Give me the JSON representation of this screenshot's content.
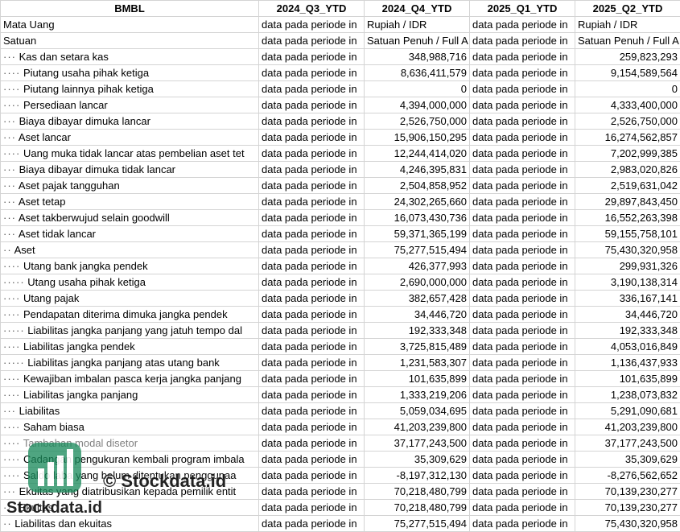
{
  "header": {
    "col0": "BMBL",
    "periods": [
      "2024_Q3_YTD",
      "2024_Q4_YTD",
      "2025_Q1_YTD",
      "2025_Q2_YTD"
    ]
  },
  "rows": [
    {
      "label": "Mata Uang",
      "dots": "",
      "v": [
        "data pada periode in",
        "Rupiah / IDR",
        "data pada periode in",
        "Rupiah / IDR"
      ],
      "t": [
        "txt",
        "txt",
        "txt",
        "txt"
      ]
    },
    {
      "label": "Satuan",
      "dots": "",
      "v": [
        "data pada periode in",
        "Satuan Penuh / Full A",
        "data pada periode in",
        "Satuan Penuh / Full A"
      ],
      "t": [
        "txt",
        "txt",
        "txt",
        "txt"
      ]
    },
    {
      "label": "Kas dan setara kas",
      "dots": "···",
      "v": [
        "data pada periode in",
        "348,988,716",
        "data pada periode in",
        "259,823,293"
      ]
    },
    {
      "label": "Piutang usaha pihak ketiga",
      "dots": "····",
      "v": [
        "data pada periode in",
        "8,636,411,579",
        "data pada periode in",
        "9,154,589,564"
      ]
    },
    {
      "label": "Piutang lainnya pihak ketiga",
      "dots": "····",
      "v": [
        "data pada periode in",
        "0",
        "data pada periode in",
        "0"
      ]
    },
    {
      "label": "Persediaan lancar",
      "dots": "····",
      "v": [
        "data pada periode in",
        "4,394,000,000",
        "data pada periode in",
        "4,333,400,000"
      ]
    },
    {
      "label": "Biaya dibayar dimuka lancar",
      "dots": "···",
      "v": [
        "data pada periode in",
        "2,526,750,000",
        "data pada periode in",
        "2,526,750,000"
      ]
    },
    {
      "label": "Aset lancar",
      "dots": "···",
      "v": [
        "data pada periode in",
        "15,906,150,295",
        "data pada periode in",
        "16,274,562,857"
      ]
    },
    {
      "label": "Uang muka tidak lancar atas pembelian aset tet",
      "dots": "····",
      "v": [
        "data pada periode in",
        "12,244,414,020",
        "data pada periode in",
        "7,202,999,385"
      ]
    },
    {
      "label": "Biaya dibayar dimuka tidak lancar",
      "dots": "···",
      "v": [
        "data pada periode in",
        "4,246,395,831",
        "data pada periode in",
        "2,983,020,826"
      ]
    },
    {
      "label": "Aset pajak tangguhan",
      "dots": "···",
      "v": [
        "data pada periode in",
        "2,504,858,952",
        "data pada periode in",
        "2,519,631,042"
      ]
    },
    {
      "label": "Aset tetap",
      "dots": "···",
      "v": [
        "data pada periode in",
        "24,302,265,660",
        "data pada periode in",
        "29,897,843,450"
      ]
    },
    {
      "label": "Aset takberwujud selain goodwill",
      "dots": "···",
      "v": [
        "data pada periode in",
        "16,073,430,736",
        "data pada periode in",
        "16,552,263,398"
      ]
    },
    {
      "label": "Aset tidak lancar",
      "dots": "···",
      "v": [
        "data pada periode in",
        "59,371,365,199",
        "data pada periode in",
        "59,155,758,101"
      ]
    },
    {
      "label": "Aset",
      "dots": "··",
      "v": [
        "data pada periode in",
        "75,277,515,494",
        "data pada periode in",
        "75,430,320,958"
      ]
    },
    {
      "label": "Utang bank jangka pendek",
      "dots": "····",
      "v": [
        "data pada periode in",
        "426,377,993",
        "data pada periode in",
        "299,931,326"
      ]
    },
    {
      "label": "Utang usaha pihak ketiga",
      "dots": "·····",
      "v": [
        "data pada periode in",
        "2,690,000,000",
        "data pada periode in",
        "3,190,138,314"
      ]
    },
    {
      "label": "Utang pajak",
      "dots": "····",
      "v": [
        "data pada periode in",
        "382,657,428",
        "data pada periode in",
        "336,167,141"
      ]
    },
    {
      "label": "Pendapatan diterima dimuka jangka pendek",
      "dots": "····",
      "v": [
        "data pada periode in",
        "34,446,720",
        "data pada periode in",
        "34,446,720"
      ]
    },
    {
      "label": "Liabilitas jangka panjang yang jatuh tempo dal",
      "dots": "·····",
      "v": [
        "data pada periode in",
        "192,333,348",
        "data pada periode in",
        "192,333,348"
      ]
    },
    {
      "label": "Liabilitas jangka pendek",
      "dots": "····",
      "v": [
        "data pada periode in",
        "3,725,815,489",
        "data pada periode in",
        "4,053,016,849"
      ]
    },
    {
      "label": "Liabilitas jangka panjang atas utang bank",
      "dots": "·····",
      "v": [
        "data pada periode in",
        "1,231,583,307",
        "data pada periode in",
        "1,136,437,933"
      ]
    },
    {
      "label": "Kewajiban imbalan pasca kerja jangka panjang",
      "dots": "····",
      "v": [
        "data pada periode in",
        "101,635,899",
        "data pada periode in",
        "101,635,899"
      ]
    },
    {
      "label": "Liabilitas jangka panjang",
      "dots": "····",
      "v": [
        "data pada periode in",
        "1,333,219,206",
        "data pada periode in",
        "1,238,073,832"
      ]
    },
    {
      "label": "Liabilitas",
      "dots": "···",
      "v": [
        "data pada periode in",
        "5,059,034,695",
        "data pada periode in",
        "5,291,090,681"
      ]
    },
    {
      "label": "Saham biasa",
      "dots": "····",
      "v": [
        "data pada periode in",
        "41,203,239,800",
        "data pada periode in",
        "41,203,239,800"
      ]
    },
    {
      "label": "Tambahan modal disetor",
      "dots": "····",
      "faded": true,
      "v": [
        "data pada periode in",
        "37,177,243,500",
        "data pada periode in",
        "37,177,243,500"
      ]
    },
    {
      "label": "Cadangan pengukuran kembali program imbala",
      "dots": "····",
      "v": [
        "data pada periode in",
        "35,309,629",
        "data pada periode in",
        "35,309,629"
      ]
    },
    {
      "label": "Saldo laba yang belum ditentukan penggunaa",
      "dots": "····",
      "neg": true,
      "v": [
        "data pada periode in",
        "-8,197,312,130",
        "data pada periode in",
        "-8,276,562,652"
      ]
    },
    {
      "label": "Ekuitas yang diatribusikan kepada pemilik entit",
      "dots": "···",
      "v": [
        "data pada periode in",
        "70,218,480,799",
        "data pada periode in",
        "70,139,230,277"
      ]
    },
    {
      "label": "Ekuitas",
      "dots": "···",
      "v": [
        "data pada periode in",
        "70,218,480,799",
        "data pada periode in",
        "70,139,230,277"
      ]
    },
    {
      "label": "Liabilitas dan ekuitas",
      "dots": "··",
      "v": [
        "data pada periode in",
        "75,277,515,494",
        "data pada periode in",
        "75,430,320,958"
      ]
    }
  ],
  "watermark": {
    "line1": "© Stockdata.id",
    "line2": "Stockdata.id",
    "logo_color": "#1a8a5a"
  }
}
